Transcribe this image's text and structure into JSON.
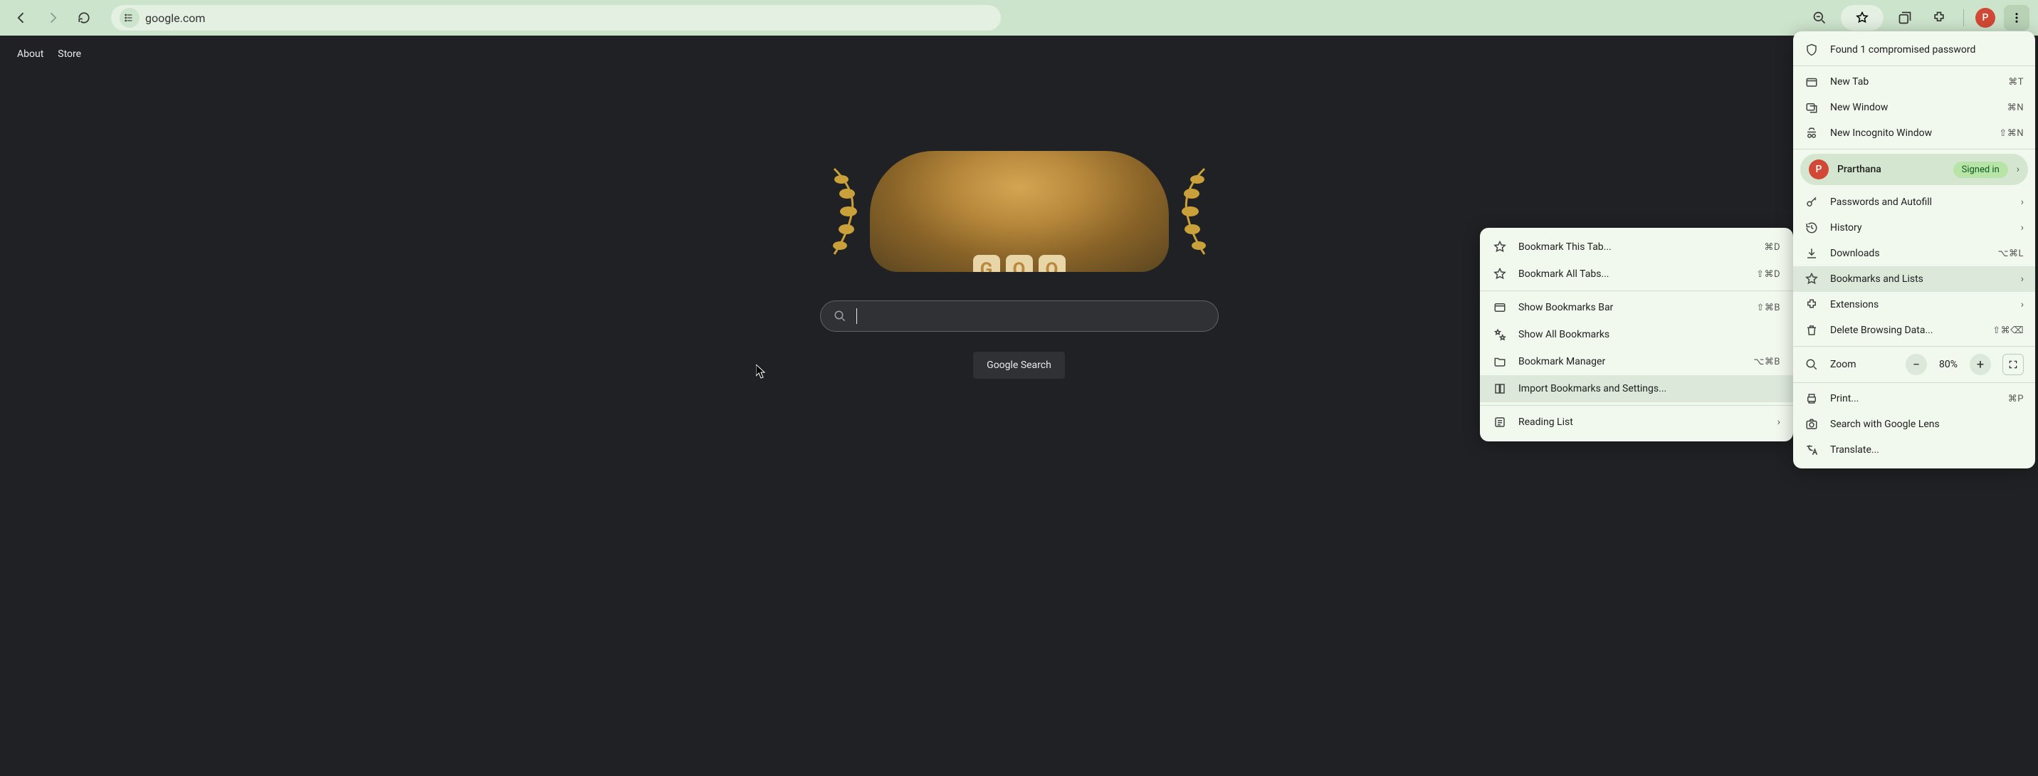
{
  "toolbar": {
    "url": "google.com",
    "zoom_icon": "zoom-out",
    "avatar_initial": "P"
  },
  "page": {
    "top_links": {
      "about": "About",
      "store": "Store"
    },
    "doodle_letters": [
      "G",
      "O",
      "O"
    ],
    "search_button": "Google Search"
  },
  "chrome_menu": {
    "alert": "Found 1 compromised password",
    "new_tab": {
      "label": "New Tab",
      "shortcut": "⌘T"
    },
    "new_window": {
      "label": "New Window",
      "shortcut": "⌘N"
    },
    "new_incognito": {
      "label": "New Incognito Window",
      "shortcut": "⇧⌘N"
    },
    "profile": {
      "name": "Prarthana",
      "badge": "Signed in",
      "initial": "P"
    },
    "passwords": "Passwords and Autofill",
    "history": "History",
    "downloads": {
      "label": "Downloads",
      "shortcut": "⌥⌘L"
    },
    "bookmarks": "Bookmarks and Lists",
    "extensions": "Extensions",
    "delete_data": {
      "label": "Delete Browsing Data...",
      "shortcut": "⇧⌘⌫"
    },
    "zoom": {
      "label": "Zoom",
      "value": "80%"
    },
    "print": {
      "label": "Print...",
      "shortcut": "⌘P"
    },
    "lens": "Search with Google Lens",
    "translate": "Translate..."
  },
  "submenu": {
    "bookmark_tab": {
      "label": "Bookmark This Tab...",
      "shortcut": "⌘D"
    },
    "bookmark_all": {
      "label": "Bookmark All Tabs...",
      "shortcut": "⇧⌘D"
    },
    "show_bar": {
      "label": "Show Bookmarks Bar",
      "shortcut": "⇧⌘B"
    },
    "show_all": "Show All Bookmarks",
    "manager": {
      "label": "Bookmark Manager",
      "shortcut": "⌥⌘B"
    },
    "import": "Import Bookmarks and Settings...",
    "reading_list": "Reading List"
  }
}
